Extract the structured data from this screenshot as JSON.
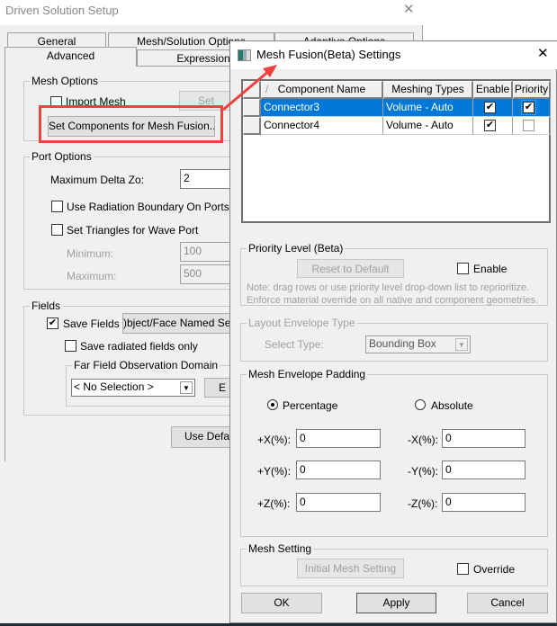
{
  "back_dialog": {
    "title": "Driven Solution Setup",
    "tabs_row1": [
      "General",
      "Mesh/Solution Options",
      "Adaptive Options"
    ],
    "tabs_row2": [
      "Advanced",
      "Expression C"
    ],
    "mesh_options": {
      "label": "Mesh Options",
      "import_mesh": "Import Mesh",
      "setup_button": "Set",
      "set_components_button": "Set Components for Mesh Fusion..."
    },
    "port_options": {
      "label": "Port Options",
      "max_delta_label": "Maximum Delta Zo:",
      "max_delta_value": "2",
      "use_radiation": "Use Radiation Boundary On Ports",
      "set_triangles": "Set Triangles for Wave Port",
      "minimum_label": "Minimum:",
      "minimum_value": "100",
      "maximum_label": "Maximum:",
      "maximum_value": "500"
    },
    "fields": {
      "label": "Fields",
      "save_fields": "Save Fields",
      "named_selection_button": ")bject/Face Named Sele",
      "save_radiated": "Save radiated fields only",
      "far_field_label": "Far Field Observation Domain",
      "far_field_value": "< No Selection >",
      "edit_button": "E"
    },
    "use_defaults_button": "Use Defau"
  },
  "mesh_fusion_dialog": {
    "title": "Mesh Fusion(Beta) Settings",
    "columns": [
      "/",
      "Component Name",
      "Meshing Types",
      "Enable",
      "Priority"
    ],
    "rows": [
      {
        "name": "Connector3",
        "type": "Volume - Auto",
        "enable": true,
        "priority": true,
        "selected": true
      },
      {
        "name": "Connector4",
        "type": "Volume - Auto",
        "enable": true,
        "priority": false,
        "selected": false
      }
    ],
    "priority_level": {
      "label": "Priority Level (Beta)",
      "reset_button": "Reset to Default",
      "enable_label": "Enable",
      "note_line1": "Note: drag rows or use priority level drop-down list to reprioritize.",
      "note_line2": "Enforce material override on all native and component geometries."
    },
    "layout_envelope": {
      "label": "Layout Envelope Type",
      "select_label": "Select Type:",
      "select_value": "Bounding Box"
    },
    "padding": {
      "label": "Mesh Envelope Padding",
      "percentage": "Percentage",
      "absolute": "Absolute",
      "fields": [
        {
          "label": "+X(%):",
          "value": "0"
        },
        {
          "label": "-X(%):",
          "value": "0"
        },
        {
          "label": "+Y(%):",
          "value": "0"
        },
        {
          "label": "-Y(%):",
          "value": "0"
        },
        {
          "label": "+Z(%):",
          "value": "0"
        },
        {
          "label": "-Z(%):",
          "value": "0"
        }
      ]
    },
    "mesh_setting": {
      "label": "Mesh Setting",
      "initial_button": "Initial Mesh Setting",
      "override_label": "Override"
    },
    "ok": "OK",
    "apply": "Apply",
    "cancel": "Cancel",
    "check_mark": "✔",
    "close_glyph": "✕"
  },
  "colors": {
    "selection": "#0078d7",
    "highlight": "#f04040"
  }
}
